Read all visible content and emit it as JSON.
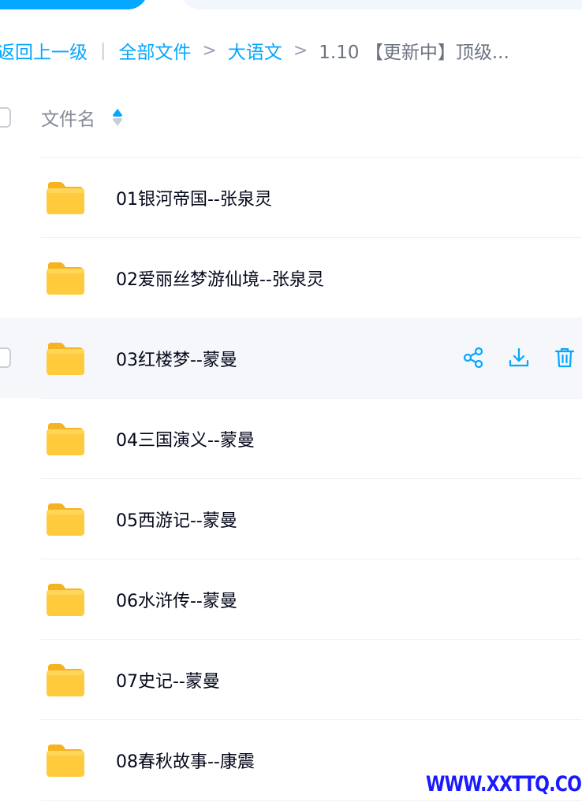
{
  "breadcrumb": {
    "back_label": "返回上一级",
    "separator_bar": "|",
    "separator_arrow": ">",
    "items": [
      "全部文件",
      "大语文"
    ],
    "current": "1.10 【更新中】顶级..."
  },
  "list_header": {
    "name_column": "文件名"
  },
  "files": [
    {
      "name": "01银河帝国--张泉灵"
    },
    {
      "name": "02爱丽丝梦游仙境--张泉灵"
    },
    {
      "name": "03红楼梦--蒙曼"
    },
    {
      "name": "04三国演义--蒙曼"
    },
    {
      "name": "05西游记--蒙曼"
    },
    {
      "name": "06水浒传--蒙曼"
    },
    {
      "name": "07史记--蒙曼"
    },
    {
      "name": "08春秋故事--康震"
    }
  ],
  "hovered_row_index": 2,
  "row_actions": [
    "share-icon",
    "download-icon",
    "delete-icon"
  ],
  "watermark": "WWW.XXTTQ.COM",
  "colors": {
    "accent": "#06a7ff",
    "folder": "#ffc933",
    "text": "#03081a",
    "muted": "#858b96",
    "hover_bg": "#f5f7fa",
    "watermark": "#1a1aff"
  }
}
